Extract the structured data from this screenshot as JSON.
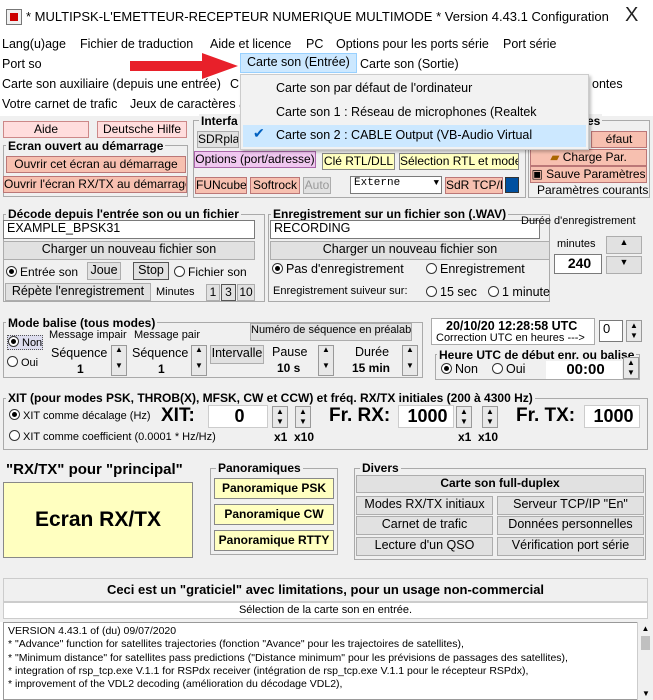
{
  "title": "* MULTIPSK-L'EMETTEUR-RECEPTEUR NUMERIQUE MULTIMODE * Version 4.43.1   Configuration",
  "close": "X",
  "menu": {
    "row1": [
      "Lang(u)age",
      "Fichier de traduction",
      "Aide et licence",
      "PC",
      "Options pour les ports série",
      "Port série"
    ],
    "row2_left": "Port so",
    "row2_sel": "Carte son (Entrée)",
    "row2_right": "Carte son (Sortie)",
    "row3_left": "Carte son auxiliaire (depuis une entrée)",
    "row3_c": "C",
    "row3_right": "ontes",
    "row4_left": "Votre carnet de trafic",
    "row4_mid": "Jeux de caractères a"
  },
  "dropdown": {
    "items": [
      "Carte son par défaut de l'ordinateur",
      "Carte son 1 : Réseau de microphones (Realtek",
      "Carte son 2 : CABLE Output (VB-Audio Virtual"
    ],
    "checkmark": "✔"
  },
  "left_top": {
    "aide": "Aide",
    "deutsche": "Deutsche Hilfe",
    "ecran_grp": "Ecran ouvert au démarrage",
    "ouvrir1": "Ouvrir cet écran au démarrage",
    "ouvrir2": "Ouvrir l'écran RX/TX au démarrage"
  },
  "interface": {
    "title": "Interfa",
    "sdrplay": "SDRplay",
    "options": "Options (port/adresse)",
    "cle": "Clé RTL/DLL",
    "selection": "Sélection RTL et mode",
    "funcube": "FUNcube",
    "softrock": "Softrock",
    "auto": "Auto",
    "externe": "Externe",
    "sdrtcp": "SdR TCP/IP"
  },
  "right_top": {
    "grp": "es",
    "defaut": "éfaut",
    "charge": "Charge Par.",
    "sauve": "Sauve Paramètres",
    "courants": "Paramètres courants"
  },
  "decode": {
    "title": "Décode depuis l'entrée son ou un fichier",
    "file": "EXAMPLE_BPSK31",
    "charger": "Charger un nouveau fichier son",
    "entree": "Entrée son",
    "joue": "Joue",
    "stop": "Stop",
    "fichier": "Fichier son",
    "repete": "Répète l'enregistrement",
    "minutes": "Minutes",
    "m1": "1",
    "m3": "3",
    "m10": "10"
  },
  "enreg": {
    "title": "Enregistrement sur un fichier son (.WAV)",
    "file": "RECORDING",
    "charger": "Charger un nouveau fichier son",
    "pas": "Pas d'enregistrement",
    "enr": "Enregistrement",
    "suiveur": "Enregistrement suiveur sur:",
    "s15": "15 sec",
    "m1": "1 minute"
  },
  "duree": {
    "label": "Durée d'enregistrement",
    "minutes": "minutes",
    "value": "240"
  },
  "balise": {
    "title": "Mode balise (tous modes)",
    "non": "Non",
    "oui": "Oui",
    "msg_impair": "Message impair",
    "msg_pair": "Message pair",
    "seq1": "Séquence",
    "seq2": "Séquence",
    "v1": "1",
    "v2": "1",
    "intervalle": "Intervalle",
    "pause": "Pause",
    "pause_v": "10 s",
    "duree": "Durée",
    "duree_v": "15 min",
    "numero": "Numéro de séquence en préalable"
  },
  "utc": {
    "date": "20/10/20 12:28:58 UTC",
    "correction": "Correction UTC en heures --->",
    "corr_v": "0",
    "heure_title": "Heure UTC de début enr. ou balise",
    "non": "Non",
    "oui": "Oui",
    "time": "00:00"
  },
  "xit": {
    "title": "XIT (pour modes PSK, THROB(X), MFSK, CW et CCW) et fréq. RX/TX initiales (200 à 4300 Hz)",
    "decal": "XIT comme décalage (Hz)",
    "coef": "XIT comme coefficient (0.0001 * Hz/Hz)",
    "xit_label": "XIT:",
    "xit_v": "0",
    "rx_label": "Fr. RX:",
    "rx_v": "1000",
    "tx_label": "Fr. TX:",
    "tx_v": "1000",
    "x1": "x1",
    "x10": "x10"
  },
  "rxtx": {
    "label": "\"RX/TX\" pour \"principal\"",
    "ecran": "Ecran RX/TX"
  },
  "pano": {
    "title": "Panoramiques",
    "psk": "Panoramique PSK",
    "cw": "Panoramique CW",
    "rtty": "Panoramique RTTY"
  },
  "divers": {
    "title": "Divers",
    "duplex": "Carte son full-duplex",
    "modes": "Modes RX/TX initiaux",
    "serveur": "Serveur TCP/IP \"En\"",
    "carnet": "Carnet de trafic",
    "donnees": "Données personnelles",
    "lecture": "Lecture d'un QSO",
    "verif": "Vérification port série"
  },
  "banner": "Ceci est un \"graticiel\" avec limitations, pour un usage non-commercial",
  "status": "Sélection de la carte son en entrée.",
  "log": [
    "VERSION 4.43.1 of (du) 09/07/2020",
    "* \"Advance\" function for satellites trajectories (fonction \"Avance\" pour les trajectoires de satellites),",
    "* \"Minimum distance\" for satellites pass predictions (\"Distance minimum\" pour les prévisions de passages des satellites),",
    "* integration of rsp_tcp.exe V.1.1 for RSPdx receiver (intégration de rsp_tcp.exe V.1.1 pour le récepteur RSPdx),",
    "* improvement of the VDL2 decoding (amélioration du décodage VDL2),"
  ]
}
